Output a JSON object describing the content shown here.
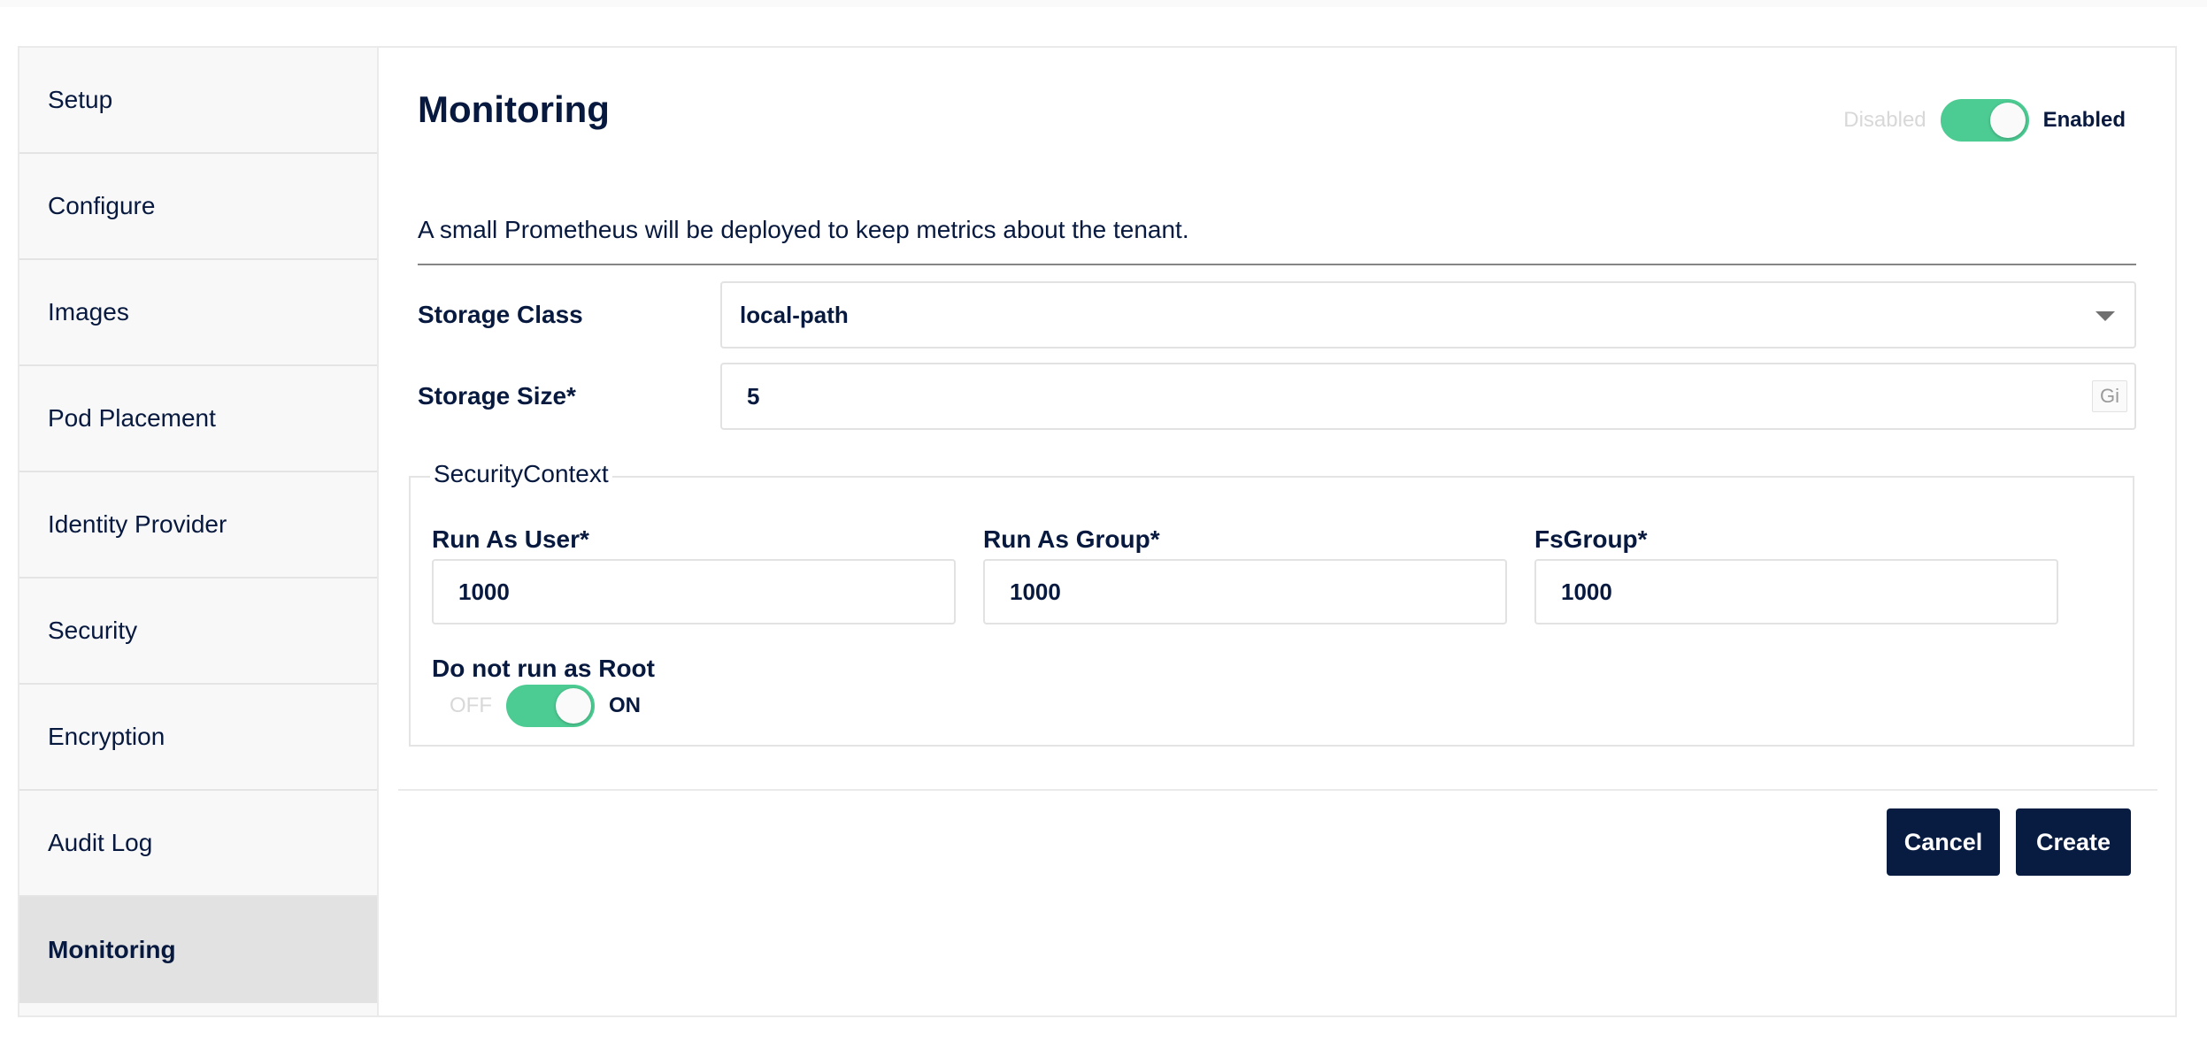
{
  "sidebar": {
    "items": [
      {
        "label": "Setup"
      },
      {
        "label": "Configure"
      },
      {
        "label": "Images"
      },
      {
        "label": "Pod Placement"
      },
      {
        "label": "Identity Provider"
      },
      {
        "label": "Security"
      },
      {
        "label": "Encryption"
      },
      {
        "label": "Audit Log"
      },
      {
        "label": "Monitoring"
      }
    ],
    "active_item": "Monitoring"
  },
  "monitoring": {
    "title": "Monitoring",
    "toggle": {
      "off_label": "Disabled",
      "on_label": "Enabled",
      "state": true
    },
    "description": "A small Prometheus will be deployed to keep metrics about the tenant.",
    "storage_class": {
      "label": "Storage Class",
      "value": "local-path"
    },
    "storage_size": {
      "label": "Storage Size*",
      "value": "5",
      "unit": "Gi"
    },
    "security_context": {
      "legend": "SecurityContext",
      "run_as_user": {
        "label": "Run As User*",
        "value": "1000"
      },
      "run_as_group": {
        "label": "Run As Group*",
        "value": "1000"
      },
      "fs_group": {
        "label": "FsGroup*",
        "value": "1000"
      },
      "run_as_non_root": {
        "label": "Do not run as Root",
        "off_label": "OFF",
        "on_label": "ON",
        "state": true
      }
    }
  },
  "actions": {
    "cancel_label": "Cancel",
    "create_label": "Create"
  },
  "colors": {
    "toggle_on": "#4ccb92",
    "button_bg": "#081c42",
    "text": "#07193e",
    "sidebar_bg": "#f8f8f8",
    "sidebar_active_bg": "#e2e2e2"
  }
}
